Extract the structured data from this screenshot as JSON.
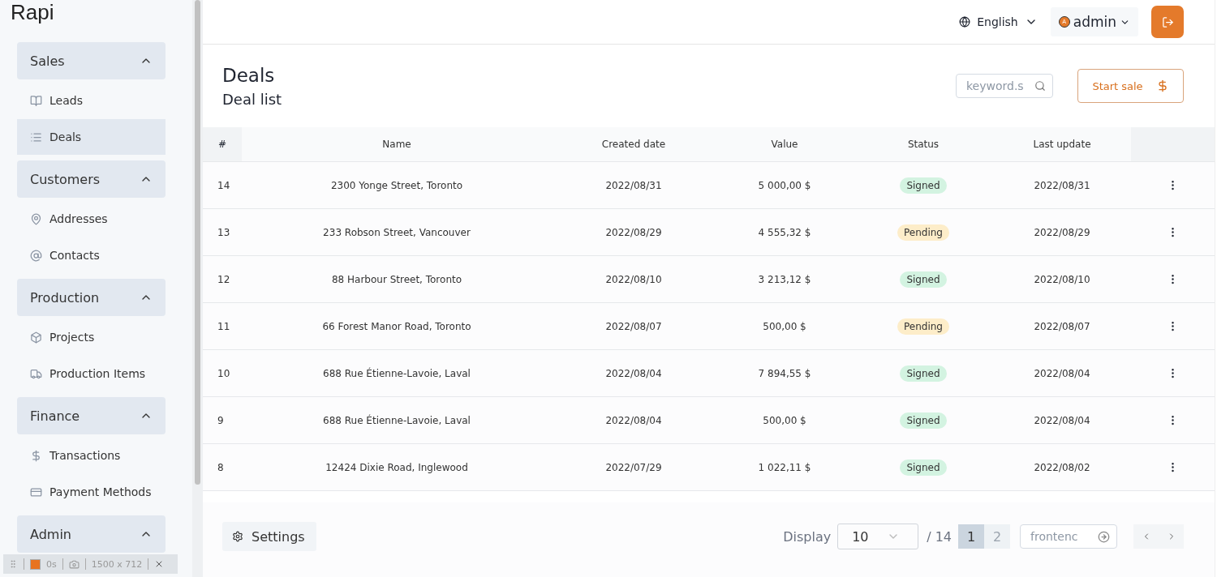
{
  "logo": "Rapi",
  "sidebar": {
    "groups": [
      {
        "label": "Sales",
        "expanded": true,
        "items": [
          {
            "label": "Leads",
            "selected": false
          },
          {
            "label": "Deals",
            "selected": true
          }
        ]
      },
      {
        "label": "Customers",
        "expanded": true,
        "items": [
          {
            "label": "Addresses",
            "selected": false
          },
          {
            "label": "Contacts",
            "selected": false
          }
        ]
      },
      {
        "label": "Production",
        "expanded": true,
        "items": [
          {
            "label": "Projects",
            "selected": false
          },
          {
            "label": "Production Items",
            "selected": false
          }
        ]
      },
      {
        "label": "Finance",
        "expanded": true,
        "items": [
          {
            "label": "Transactions",
            "selected": false
          },
          {
            "label": "Payment Methods",
            "selected": false
          }
        ]
      },
      {
        "label": "Admin",
        "expanded": true
      }
    ]
  },
  "header": {
    "language": "English",
    "user": "admin",
    "avatar": "A"
  },
  "page": {
    "title": "Deals",
    "subtitle": "Deal list",
    "search": {
      "placeholder": "keyword.s"
    },
    "action": "Start sale"
  },
  "table": {
    "columns": [
      "#",
      "Name",
      "Created date",
      "Value",
      "Status",
      "Last update"
    ],
    "rows": [
      {
        "id": "14",
        "name": "2300 Yonge Street, Toronto",
        "created": "2022/08/31",
        "value": "5 000,00 $",
        "status": "Signed",
        "color": "#d3f3e1",
        "updated": "2022/08/31"
      },
      {
        "id": "13",
        "name": "233 Robson Street, Vancouver",
        "created": "2022/08/29",
        "value": "4 555,32 $",
        "status": "Pending",
        "color": "#fdedc9",
        "updated": "2022/08/29"
      },
      {
        "id": "12",
        "name": "88 Harbour Street, Toronto",
        "created": "2022/08/10",
        "value": "3 213,12 $",
        "status": "Signed",
        "color": "#d3f3e1",
        "updated": "2022/08/10"
      },
      {
        "id": "11",
        "name": "66 Forest Manor Road, Toronto",
        "created": "2022/08/07",
        "value": "500,00 $",
        "status": "Pending",
        "color": "#fdedc9",
        "updated": "2022/08/07"
      },
      {
        "id": "10",
        "name": "688 Rue Étienne-Lavoie, Laval",
        "created": "2022/08/04",
        "value": "7 894,55 $",
        "status": "Signed",
        "color": "#d3f3e1",
        "updated": "2022/08/04"
      },
      {
        "id": "9",
        "name": "688 Rue Étienne-Lavoie, Laval",
        "created": "2022/08/04",
        "value": "500,00 $",
        "status": "Signed",
        "color": "#d3f3e1",
        "updated": "2022/08/04"
      },
      {
        "id": "8",
        "name": "12424 Dixie Road, Inglewood",
        "created": "2022/07/29",
        "value": "1 022,11 $",
        "status": "Signed",
        "color": "#d3f3e1",
        "updated": "2022/08/02"
      }
    ]
  },
  "footer": {
    "settings": "Settings",
    "display_label": "Display",
    "page_size": "10",
    "total": "/ 14",
    "pages": [
      {
        "label": "1",
        "selected": true
      },
      {
        "label": "2",
        "selected": false
      }
    ],
    "goto": {
      "placeholder": "frontenc"
    }
  },
  "recorder": {
    "time": "0s",
    "size": "1500 x 712"
  }
}
